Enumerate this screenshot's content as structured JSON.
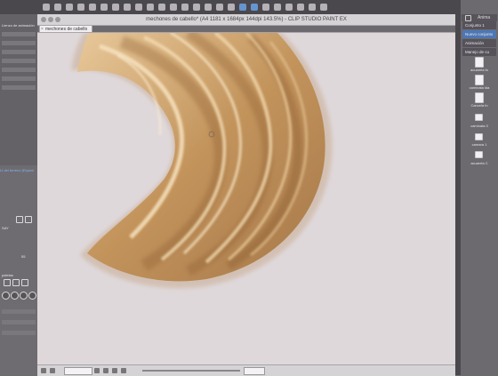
{
  "window": {
    "title": "mechones de cabello* (A4 1181 x 1684px 144dpi 143.5%)  - CLIP STUDIO PAINT EX",
    "tab_label": "mechones de cabello"
  },
  "colors": {
    "canvas_bg": "#dfd8da",
    "hair_light": "#f0d9b4",
    "hair_mid": "#c99a62",
    "hair_dark": "#9a6a3c",
    "accent_blue": "#4c77b4"
  },
  "toolbar": {
    "icons": [
      "new-file-icon",
      "open-file-icon",
      "save-icon",
      "undo-icon",
      "redo-icon",
      "clear-icon",
      "transform-icon",
      "select-icon",
      "deselect-icon",
      "invert-select-icon",
      "selection-layer-icon",
      "fill-icon",
      "snap-icon",
      "ruler-icon",
      "grid-icon",
      "rotate-icon",
      "flip-icon",
      "zoom-icon",
      "hand-icon",
      "eyedropper-icon",
      "pen-icon",
      "brush-icon",
      "eraser-icon",
      "blend-icon",
      "color-icon"
    ]
  },
  "left_panel": {
    "top_text": "Lienzo de animación",
    "blue_text": "Lt del terreno (Especi",
    "label_1": "SAY",
    "label_2": "paletas",
    "value_1": "55"
  },
  "right_panel": {
    "header_label": "Anima",
    "buttons": [
      "Conjunto 1",
      "Nuevo conjunto",
      "Animación",
      "Manejo de cu"
    ],
    "items": [
      {
        "label": "acuarela fo"
      },
      {
        "label": "caminata lda"
      },
      {
        "label": "Cancela fo"
      },
      {
        "label": "caminata 3"
      },
      {
        "label": "camara 1"
      },
      {
        "label": "acuarela C"
      }
    ]
  }
}
